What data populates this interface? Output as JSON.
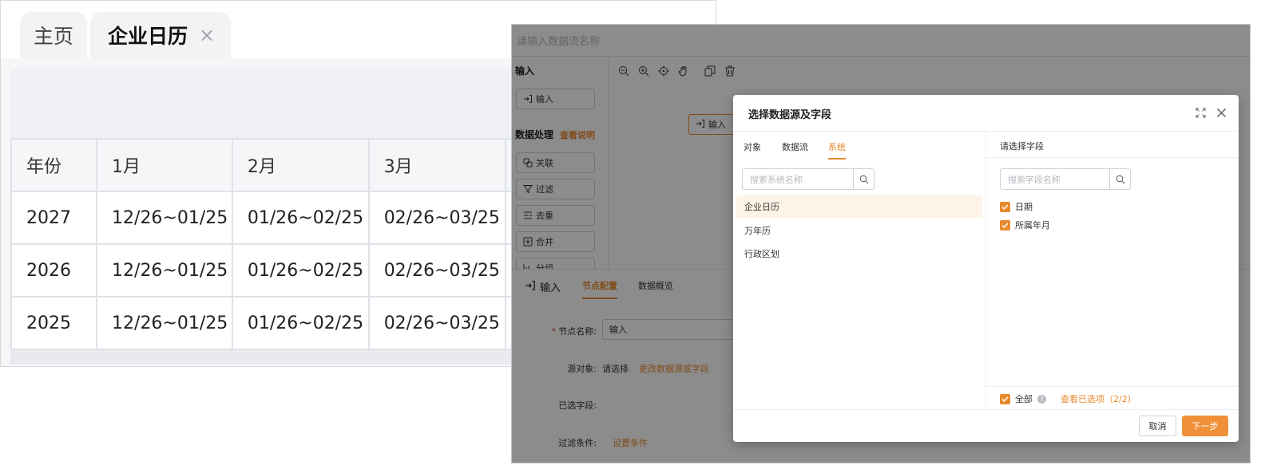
{
  "calendar": {
    "tabs": [
      {
        "label": "主页"
      },
      {
        "label": "企业日历",
        "close": "×"
      }
    ],
    "table": {
      "headers": [
        "年份",
        "1月",
        "2月",
        "3月",
        ""
      ],
      "rows": [
        [
          "2027",
          "12/26~01/25",
          "01/26~02/25",
          "02/26~03/25",
          ""
        ],
        [
          "2026",
          "12/26~01/25",
          "01/26~02/25",
          "02/26~03/25",
          ""
        ],
        [
          "2025",
          "12/26~01/25",
          "01/26~02/25",
          "02/26~03/25",
          ""
        ]
      ]
    }
  },
  "flow": {
    "name_placeholder": "请输入数据流名称",
    "input_section": {
      "title": "输入",
      "button": "输入"
    },
    "processing_section": {
      "title": "数据处理",
      "help": "查看说明",
      "nodes": [
        {
          "label": "关联",
          "icon": "link-icon"
        },
        {
          "label": "过滤",
          "icon": "filter-icon"
        },
        {
          "label": "去重",
          "icon": "dedupe-icon"
        },
        {
          "label": "合并",
          "icon": "merge-icon"
        },
        {
          "label": "分组",
          "icon": "group-icon"
        }
      ]
    },
    "toolbar": [
      "zoom-out-icon",
      "zoom-in-icon",
      "locate-icon",
      "hand-icon",
      "copy-icon",
      "delete-icon"
    ],
    "canvas_node": "输入",
    "config": {
      "title": "输入",
      "tabs": [
        {
          "label": "节点配置",
          "active": true
        },
        {
          "label": "数据概览",
          "active": false
        }
      ],
      "node_name_label": "节点名称:",
      "node_name_value": "输入",
      "source_label": "源对象:",
      "source_value": "请选择",
      "source_link": "更改数据源或字段",
      "selected_fields_label": "已选字段:",
      "filter_label": "过滤条件:",
      "filter_link": "设置条件"
    }
  },
  "modal": {
    "title": "选择数据源及字段",
    "tabs": [
      {
        "label": "对象",
        "active": false
      },
      {
        "label": "数据流",
        "active": false
      },
      {
        "label": "系统",
        "active": true
      }
    ],
    "source_search_placeholder": "搜索系统名称",
    "sources": [
      {
        "label": "企业日历",
        "selected": true
      },
      {
        "label": "万年历",
        "selected": false
      },
      {
        "label": "行政区划",
        "selected": false
      }
    ],
    "field_title": "请选择字段",
    "field_search_placeholder": "搜索字段名称",
    "fields": [
      {
        "label": "日期",
        "checked": true
      },
      {
        "label": "所属年月",
        "checked": true
      }
    ],
    "all_label": "全部",
    "help_glyph": "?",
    "selected_link": "查看已选项（2/2）",
    "cancel": "取消",
    "next": "下一步"
  },
  "colors": {
    "accent": "#e88a2e",
    "overlay": "rgba(0,0,0,0.45)"
  }
}
